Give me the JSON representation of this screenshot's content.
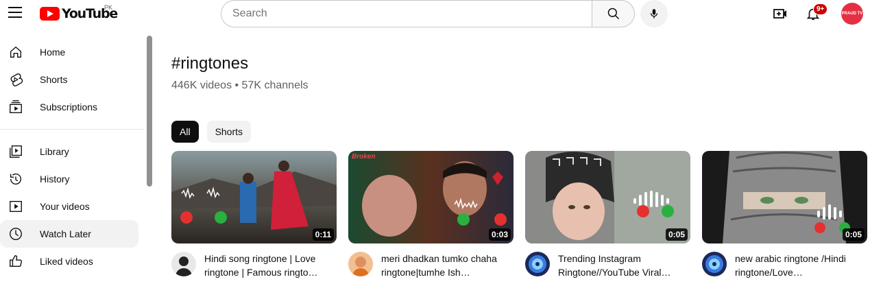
{
  "header": {
    "logo_text": "YouTube",
    "region": "PK",
    "search_placeholder": "Search",
    "notification_count": "9+",
    "avatar_text": "PRAUD TV"
  },
  "sidebar": {
    "items": [
      {
        "label": "Home",
        "icon": "home-icon"
      },
      {
        "label": "Shorts",
        "icon": "shorts-icon"
      },
      {
        "label": "Subscriptions",
        "icon": "subscriptions-icon"
      },
      {
        "label": "Library",
        "icon": "library-icon"
      },
      {
        "label": "History",
        "icon": "history-icon"
      },
      {
        "label": "Your videos",
        "icon": "your-videos-icon"
      },
      {
        "label": "Watch Later",
        "icon": "watch-later-icon",
        "active": true
      },
      {
        "label": "Liked videos",
        "icon": "liked-videos-icon"
      }
    ]
  },
  "page": {
    "hashtag": "#ringtones",
    "meta": "446K videos • 57K channels",
    "chips": [
      "All",
      "Shorts"
    ]
  },
  "videos": [
    {
      "title": "Hindi song ringtone | Love ringtone | Famous ringto…",
      "duration": "0:11",
      "thumb_color": "#4a5a4e"
    },
    {
      "title": "meri dhadkan tumko chaha ringtone|tumhe Ish…",
      "duration": "0:03",
      "thumb_color": "#5a3a30",
      "overlay": "Broken"
    },
    {
      "title": "Trending Instagram Ringtone//YouTube Viral…",
      "duration": "0:05",
      "thumb_color": "#6a6a6a"
    },
    {
      "title": "new arabic ringtone /Hindi ringtone/Love…",
      "duration": "0:05",
      "thumb_color": "#3a3a3a"
    }
  ],
  "colors": {
    "accent": "#ff0000",
    "badge": "#cc0000",
    "active_chip": "#0f0f0f"
  }
}
